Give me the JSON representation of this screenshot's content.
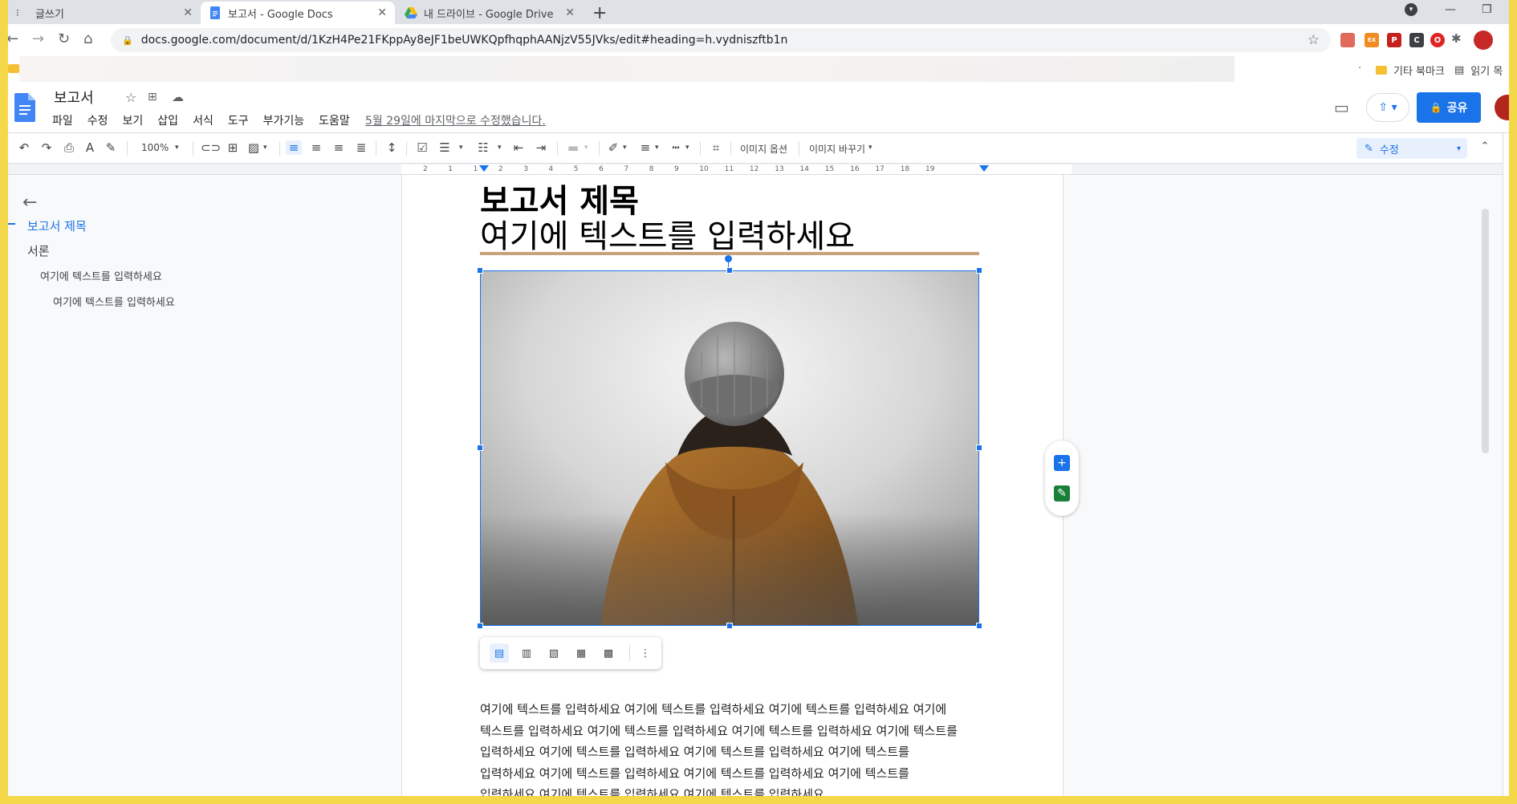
{
  "browser": {
    "tabs": [
      {
        "title": "글쓰기",
        "active": false
      },
      {
        "title": "보고서 - Google Docs",
        "active": true
      },
      {
        "title": "내 드라이브 - Google Drive",
        "active": false
      }
    ],
    "new_tab_glyph": "+",
    "url": "docs.google.com/document/d/1KzH4Pe21FKppAy8eJF1beUWKQpfhqphAANjzV55JVks/edit#heading=h.vydniszftb1n",
    "bookmarks": {
      "other_bookmarks": "기타 북마크",
      "reading_list": "읽기 목"
    },
    "extensions": [
      {
        "name": "cast-icon",
        "color": "#e06b5b",
        "label": ""
      },
      {
        "name": "ext-ex-icon",
        "color": "#f28b22",
        "label": "EX"
      },
      {
        "name": "ext-red-icon",
        "color": "#c5221f",
        "label": "P"
      },
      {
        "name": "ext-c-icon",
        "color": "#3c4043",
        "label": "C"
      },
      {
        "name": "opera-icon",
        "color": "#e02424",
        "label": "O"
      }
    ]
  },
  "docs": {
    "title": "보고서",
    "menu": [
      "파일",
      "수정",
      "보기",
      "삽입",
      "서식",
      "도구",
      "부가기능",
      "도움말"
    ],
    "last_edit": "5월 29일에 마지막으로 수정했습니다.",
    "share_label": "공유",
    "toolbar": {
      "zoom": "100%",
      "image_options": "이미지 옵션",
      "replace_image": "이미지 바꾸기",
      "mode": "수정"
    },
    "ruler": [
      "2",
      "1",
      "1",
      "2",
      "3",
      "4",
      "5",
      "6",
      "7",
      "8",
      "9",
      "10",
      "11",
      "12",
      "13",
      "14",
      "15",
      "16",
      "17",
      "18",
      "19"
    ]
  },
  "outline": {
    "items": [
      {
        "label": "보고서 제목",
        "level": 0,
        "active": true
      },
      {
        "label": "서론",
        "level": 1,
        "active": false
      },
      {
        "label": "여기에 텍스트를 입력하세요",
        "level": 2,
        "active": false
      },
      {
        "label": "여기에 텍스트를 입력하세요",
        "level": 3,
        "active": false
      }
    ]
  },
  "document": {
    "heading": "보고서 제목",
    "subheading": "여기에 텍스트를 입력하세요",
    "body_lines": [
      "여기에 텍스트를 입력하세요 여기에 텍스트를 입력하세요 여기에 텍스트를 입력하세요 여기에",
      "텍스트를 입력하세요 여기에 텍스트를 입력하세요 여기에 텍스트를 입력하세요 여기에 텍스트를",
      "입력하세요 여기에 텍스트를 입력하세요 여기에 텍스트를 입력하세요 여기에 텍스트를",
      "입력하세요 여기에 텍스트를 입력하세요 여기에 텍스트를 입력하세요 여기에 텍스트를",
      "입력하세요 여기에 텍스트를 입력하세요 여기에 텍스트를 입력하세요"
    ]
  },
  "colors": {
    "accent": "#1a73e8",
    "frame_border": "#f4d84a",
    "heading_rule": "#c9a27a"
  }
}
